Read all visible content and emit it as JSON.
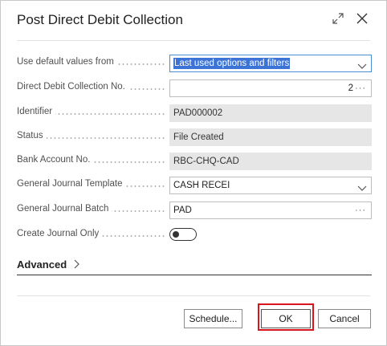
{
  "dialog": {
    "title": "Post Direct Debit Collection"
  },
  "fields": {
    "use_default": {
      "label": "Use default values from",
      "value": "Last used options and filters"
    },
    "collection_no": {
      "label": "Direct Debit Collection No.",
      "value": "2",
      "lookup": "···"
    },
    "identifier": {
      "label": "Identifier",
      "value": "PAD000002"
    },
    "status": {
      "label": "Status",
      "value": "File Created"
    },
    "bank_account": {
      "label": "Bank Account No.",
      "value": "RBC-CHQ-CAD"
    },
    "journal_template": {
      "label": "General Journal Template",
      "value": "CASH RECEI"
    },
    "journal_batch": {
      "label": "General Journal Batch",
      "value": "PAD",
      "lookup": "···"
    },
    "create_journal_only": {
      "label": "Create Journal Only",
      "value": false
    }
  },
  "advanced": {
    "label": "Advanced"
  },
  "buttons": {
    "schedule": "Schedule...",
    "ok": "OK",
    "cancel": "Cancel"
  },
  "icons": {
    "expand": "expand-icon",
    "close": "close-icon"
  },
  "colors": {
    "selection": "#3b73d6",
    "highlight_box": "#d8141c",
    "focus_border": "#4a8fd6"
  }
}
